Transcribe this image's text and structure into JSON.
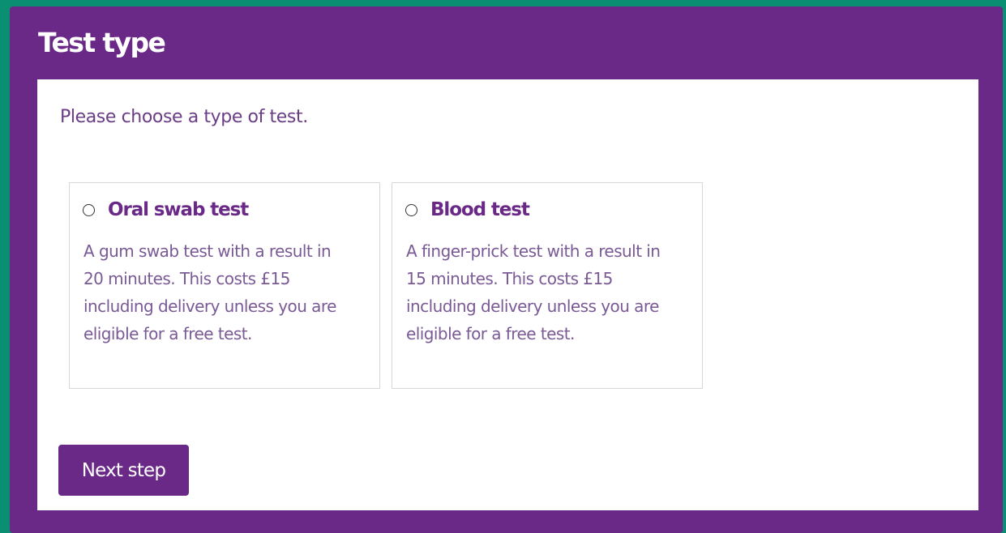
{
  "panel": {
    "title": "Test type",
    "intro": "Please choose a type of test."
  },
  "options": [
    {
      "label": "Oral swab test",
      "description": "A gum swab test with a result in 20 minutes. This costs £15 including delivery unless you are eligible for a free test.",
      "selected": false
    },
    {
      "label": "Blood test",
      "description": "A finger-prick test with a result in 15 minutes. This costs £15 including delivery unless you are eligible for a free test.",
      "selected": false
    }
  ],
  "actions": {
    "next_label": "Next step"
  },
  "colors": {
    "page_background": "#0a8f73",
    "brand_purple": "#6a2887",
    "card_border": "#d7d7d7",
    "text_muted": "#7a5a95"
  },
  "icons": {
    "radio": "radio-unchecked-icon"
  }
}
